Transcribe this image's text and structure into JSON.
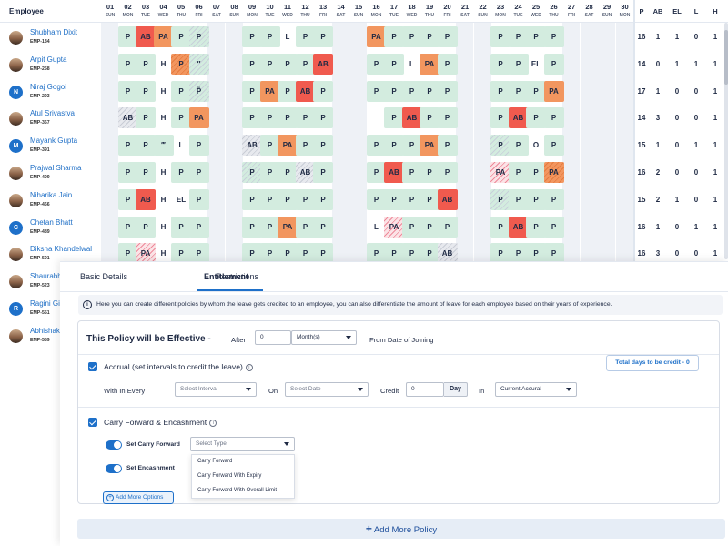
{
  "grid": {
    "employee_header": "Employee",
    "days": [
      {
        "n": "01",
        "d": "SUN",
        "weekend": true
      },
      {
        "n": "02",
        "d": "MON"
      },
      {
        "n": "03",
        "d": "TUE"
      },
      {
        "n": "04",
        "d": "WED"
      },
      {
        "n": "05",
        "d": "THU"
      },
      {
        "n": "06",
        "d": "FRI"
      },
      {
        "n": "07",
        "d": "SAT",
        "weekend": true
      },
      {
        "n": "08",
        "d": "SUN",
        "weekend": true
      },
      {
        "n": "09",
        "d": "MON"
      },
      {
        "n": "10",
        "d": "TUE"
      },
      {
        "n": "11",
        "d": "WED"
      },
      {
        "n": "12",
        "d": "THU"
      },
      {
        "n": "13",
        "d": "FRI"
      },
      {
        "n": "14",
        "d": "SAT",
        "weekend": true
      },
      {
        "n": "15",
        "d": "SUN",
        "weekend": true
      },
      {
        "n": "16",
        "d": "MON"
      },
      {
        "n": "17",
        "d": "TUE"
      },
      {
        "n": "18",
        "d": "WED"
      },
      {
        "n": "19",
        "d": "THU"
      },
      {
        "n": "20",
        "d": "FRI"
      },
      {
        "n": "21",
        "d": "SAT",
        "weekend": true
      },
      {
        "n": "22",
        "d": "SUN",
        "weekend": true
      },
      {
        "n": "23",
        "d": "MON"
      },
      {
        "n": "24",
        "d": "TUE"
      },
      {
        "n": "25",
        "d": "WED"
      },
      {
        "n": "26",
        "d": "THU"
      },
      {
        "n": "27",
        "d": "FRI",
        "weekend": true
      },
      {
        "n": "28",
        "d": "SAT",
        "weekend": true
      },
      {
        "n": "29",
        "d": "SUN",
        "weekend": true
      },
      {
        "n": "30",
        "d": "MON",
        "weekend": true
      }
    ],
    "summary_headers": [
      "P",
      "AB",
      "EL",
      "L",
      "H"
    ],
    "employees": [
      {
        "name": "Shubham Dixit",
        "code": "EMP-134",
        "avatar": "photo",
        "initial": "",
        "cells": [
          "",
          "P",
          "AB",
          "PA",
          "P",
          "P",
          "",
          "",
          "P",
          "P",
          "L",
          "P",
          "P",
          "",
          "",
          "PA",
          "P",
          "P",
          "P",
          "P",
          "",
          "",
          "P",
          "P",
          "P",
          "P",
          "",
          "",
          "",
          ""
        ],
        "summary": [
          "16",
          "1",
          "1",
          "0",
          "1"
        ]
      },
      {
        "name": "Arpit Gupta",
        "code": "EMP-258",
        "avatar": "photo",
        "initial": "",
        "cells": [
          "",
          "P",
          "P",
          "H",
          "P",
          "″",
          "",
          "",
          "P",
          "P",
          "P",
          "P",
          "AB",
          "",
          "",
          "P",
          "P",
          "L",
          "PA",
          "P",
          "",
          "",
          "P",
          "P",
          "EL",
          "P",
          "",
          "",
          "",
          ""
        ],
        "summary": [
          "14",
          "0",
          "1",
          "1",
          "1"
        ]
      },
      {
        "name": "Niraj Gogoi",
        "code": "EMP-293",
        "avatar": "initial",
        "initial": "N",
        "cells": [
          "",
          "P",
          "P",
          "H",
          "P",
          "P̃",
          "",
          "",
          "P",
          "PA",
          "P",
          "AB",
          "P",
          "",
          "",
          "P",
          "P",
          "P",
          "P",
          "P",
          "",
          "",
          "P",
          "P",
          "P",
          "PA",
          "",
          "",
          "",
          ""
        ],
        "summary": [
          "17",
          "1",
          "0",
          "0",
          "1"
        ]
      },
      {
        "name": "Atul Srivastva",
        "code": "EMP-367",
        "avatar": "photo",
        "initial": "",
        "cells": [
          "",
          "AB",
          "P",
          "H",
          "P",
          "PA",
          "",
          "",
          "P",
          "P",
          "P",
          "P",
          "P",
          "",
          "",
          "",
          "P",
          "AB",
          "P",
          "P",
          "",
          "",
          "P",
          "AB",
          "P",
          "P",
          "",
          "",
          "",
          ""
        ],
        "summary": [
          "14",
          "3",
          "0",
          "0",
          "1"
        ]
      },
      {
        "name": "Mayank Gupta",
        "code": "EMP-391",
        "avatar": "initial",
        "initial": "M",
        "cells": [
          "",
          "P",
          "P",
          "‴",
          "L",
          "P",
          "",
          "",
          "AB",
          "P",
          "PA",
          "P",
          "P",
          "",
          "",
          "P",
          "P",
          "P",
          "PA",
          "P",
          "",
          "",
          "P",
          "P",
          "O",
          "P",
          "",
          "",
          "",
          ""
        ],
        "summary": [
          "15",
          "1",
          "0",
          "1",
          "1"
        ]
      },
      {
        "name": "Prajwal Sharma",
        "code": "EMP-409",
        "avatar": "photo",
        "initial": "",
        "cells": [
          "",
          "P",
          "P",
          "H",
          "P",
          "P",
          "",
          "",
          "P",
          "P",
          "P",
          "AB",
          "P",
          "",
          "",
          "P",
          "AB",
          "P",
          "P",
          "P",
          "",
          "",
          "PA",
          "P",
          "P",
          "PA",
          "",
          "",
          "",
          ""
        ],
        "summary": [
          "16",
          "2",
          "0",
          "0",
          "1"
        ]
      },
      {
        "name": "Niharika Jain",
        "code": "EMP-466",
        "avatar": "photo",
        "initial": "",
        "cells": [
          "",
          "P",
          "AB",
          "H",
          "EL",
          "P",
          "",
          "",
          "P",
          "P",
          "P",
          "P",
          "P",
          "",
          "",
          "P",
          "P",
          "P",
          "P",
          "AB",
          "",
          "",
          "P",
          "P",
          "P",
          "P",
          "",
          "",
          "",
          ""
        ],
        "summary": [
          "15",
          "2",
          "1",
          "0",
          "1"
        ]
      },
      {
        "name": "Chetan Bhatt",
        "code": "EMP-489",
        "avatar": "initial",
        "initial": "C",
        "cells": [
          "",
          "P",
          "P",
          "H",
          "P",
          "P",
          "",
          "",
          "P",
          "P",
          "PA",
          "P",
          "P",
          "",
          "",
          "L",
          "PA",
          "P",
          "P",
          "P",
          "",
          "",
          "P",
          "AB",
          "P",
          "P",
          "",
          "",
          "",
          ""
        ],
        "summary": [
          "16",
          "1",
          "0",
          "1",
          "1"
        ]
      },
      {
        "name": "Diksha Khandelwal",
        "code": "EMP-501",
        "avatar": "photo",
        "initial": "",
        "cells": [
          "",
          "P",
          "PA",
          "H",
          "P",
          "P",
          "",
          "",
          "P",
          "P",
          "P",
          "P",
          "P",
          "",
          "",
          "P",
          "P",
          "P",
          "P",
          "AB",
          "",
          "",
          "P",
          "P",
          "P",
          "P",
          "",
          "",
          "",
          ""
        ],
        "summary": [
          "16",
          "3",
          "0",
          "0",
          "1"
        ]
      },
      {
        "name": "Shaurabh",
        "code": "EMP-523",
        "avatar": "photo",
        "initial": "",
        "cells": [],
        "summary": []
      },
      {
        "name": "Ragini Gi",
        "code": "EMP-551",
        "avatar": "initial",
        "initial": "R",
        "cells": [],
        "summary": []
      },
      {
        "name": "Abhishak",
        "code": "EMP-559",
        "avatar": "photo",
        "initial": "",
        "cells": [],
        "summary": []
      }
    ]
  },
  "panel": {
    "tabs": [
      "Basic Details",
      "Entitlement",
      "Restrictions"
    ],
    "active_tab": "Entitlement",
    "info_text": "Here you can create different policies by whom the leave gets credited to an employee, you can also differentiate the  amount of leave for each employee based on their years of experience.",
    "effective": {
      "title": "This Policy will be Effective -",
      "after_label": "After",
      "after_value": "0",
      "unit_value": "Month(s)",
      "from_label": "From Date of Joining"
    },
    "accrual": {
      "label": "Accrual (set intervals to credit the leave)",
      "total_days_button": "Total days to be credit - 0",
      "with_in_every_label": "With In Every",
      "interval_placeholder": "Select Interval",
      "on_label": "On",
      "date_placeholder": "Select Date",
      "credit_label": "Credit",
      "credit_value": "0",
      "credit_unit": "Day",
      "in_label": "In",
      "in_value": "Current Accural"
    },
    "carry_forward": {
      "label": "Carry Forward & Encashment",
      "set_carry_forward_label": "Set Carry Forward",
      "type_placeholder": "Select Type",
      "set_encashment_label": "Set Encashment",
      "options": [
        "Carry Forward",
        "Carry Forward With Expiry",
        "Carry Forward With Overall Limit"
      ],
      "add_more_options": "Add More Options"
    },
    "add_more_policy": "Add More Policy"
  },
  "colors": {
    "accent": "#1e70c9",
    "present": "#d3ecdf",
    "absent": "#f05a4e",
    "partial": "#f2965f"
  }
}
